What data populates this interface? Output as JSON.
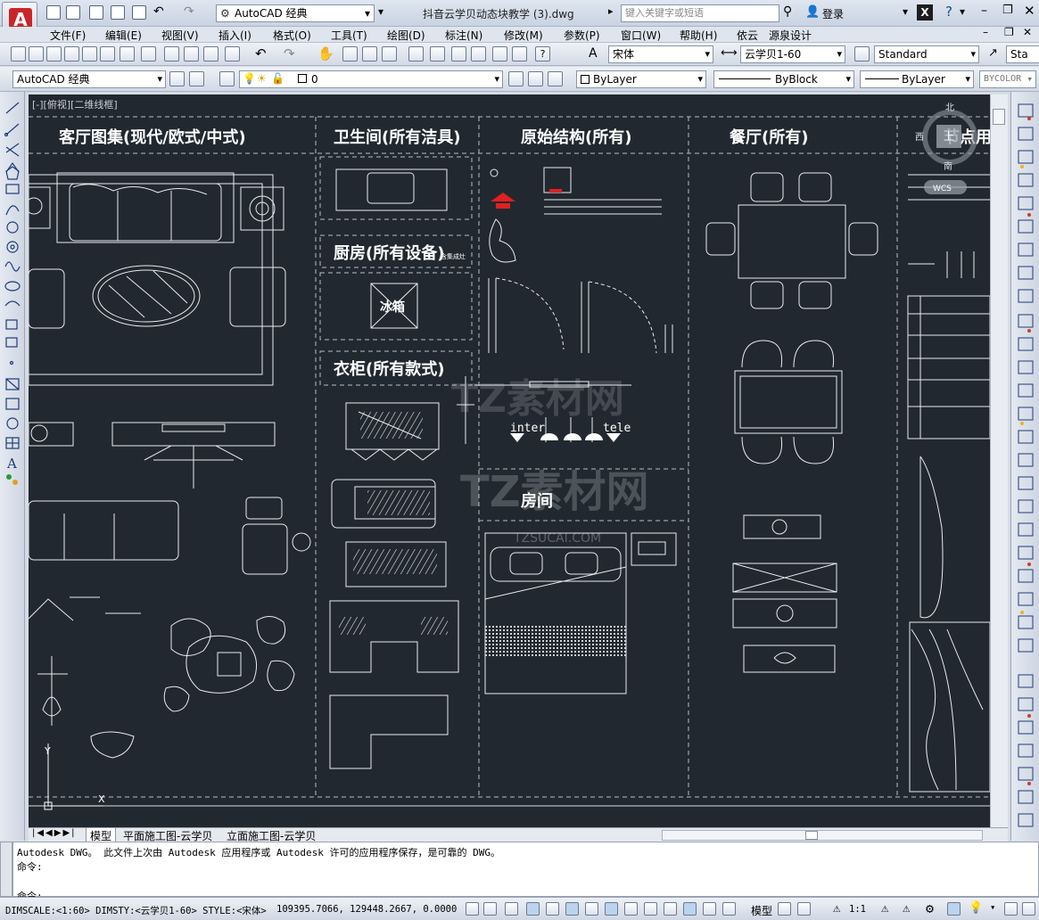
{
  "title_bar": {
    "workspace": "AutoCAD 经典",
    "document_title": "抖音云学贝动态块教学 (3).dwg",
    "search_placeholder": "键入关键字或短语",
    "login": "登录"
  },
  "menu": [
    "文件(F)",
    "编辑(E)",
    "视图(V)",
    "插入(I)",
    "格式(O)",
    "工具(T)",
    "绘图(D)",
    "标注(N)",
    "修改(M)",
    "参数(P)",
    "窗口(W)",
    "帮助(H)",
    "依云",
    "源泉设计"
  ],
  "toolbar": {
    "text_style": "宋体",
    "dim_style": "云学贝1-60",
    "table_style": "Standard",
    "multileader_style": "Sta",
    "workspace": "AutoCAD 经典",
    "layer": "0",
    "color": "ByLayer",
    "linetype": "ByBlock",
    "lineweight": "ByLayer",
    "plot_style": "BYCOLOR"
  },
  "viewport_label": "[-][俯视][二维线框]",
  "viewcube": {
    "north": "北",
    "west": "西",
    "south": "南",
    "top": "上",
    "wcs": "WCS"
  },
  "sections": {
    "living": "客厅图集(现代/欧式/中式)",
    "bathroom": "卫生间(所有洁具)",
    "structure": "原始结构(所有)",
    "dining": "餐厅(所有)",
    "nodes": "节点用材",
    "kitchen": "厨房(所有设备)",
    "kitchen_note": "含集成灶",
    "fridge": "冰箱",
    "wardrobe": "衣柜(所有款式)",
    "room": "房间",
    "inter": "inter",
    "tele": "tele"
  },
  "watermark": {
    "brand": "TZ素材网",
    "url": "TZSUCAI.COM"
  },
  "tabs": [
    "模型",
    "平面施工图-云学贝",
    "立面施工图-云学贝"
  ],
  "command": {
    "line1": "Autodesk DWG。  此文件上次由 Autodesk 应用程序或 Autodesk 许可的应用程序保存，是可靠的 DWG。",
    "line2": "命令:",
    "prompt": "命令:"
  },
  "status": {
    "info": "DIMSCALE:<1:60> DIMSTY:<云学贝1-60> STYLE:<宋体>",
    "coords": "109395.7066, 129448.2667, 0.0000",
    "model": "模型",
    "scale": "1:1"
  }
}
